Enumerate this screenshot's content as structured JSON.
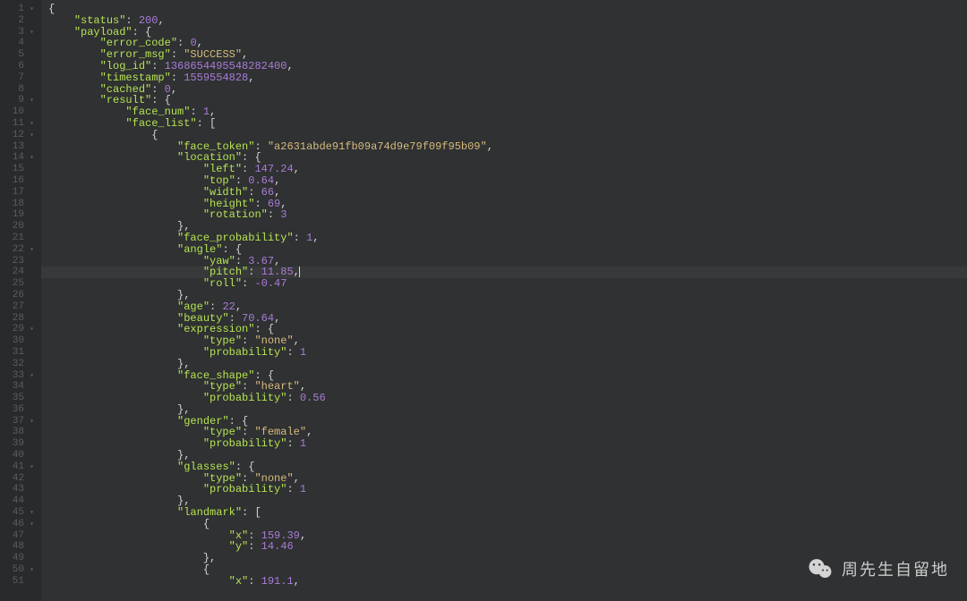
{
  "watermark_text": "周先生自留地",
  "active_line": 24,
  "code_lines": [
    {
      "num": 1,
      "fold": true,
      "indent": 0,
      "tokens": [
        {
          "t": "p",
          "v": "{"
        }
      ]
    },
    {
      "num": 2,
      "fold": false,
      "indent": 1,
      "tokens": [
        {
          "t": "k",
          "v": "\"status\""
        },
        {
          "t": "p",
          "v": ": "
        },
        {
          "t": "n",
          "v": "200"
        },
        {
          "t": "p",
          "v": ","
        }
      ]
    },
    {
      "num": 3,
      "fold": true,
      "indent": 1,
      "tokens": [
        {
          "t": "k",
          "v": "\"payload\""
        },
        {
          "t": "p",
          "v": ": {"
        }
      ]
    },
    {
      "num": 4,
      "fold": false,
      "indent": 2,
      "tokens": [
        {
          "t": "k",
          "v": "\"error_code\""
        },
        {
          "t": "p",
          "v": ": "
        },
        {
          "t": "n",
          "v": "0"
        },
        {
          "t": "p",
          "v": ","
        }
      ]
    },
    {
      "num": 5,
      "fold": false,
      "indent": 2,
      "tokens": [
        {
          "t": "k",
          "v": "\"error_msg\""
        },
        {
          "t": "p",
          "v": ": "
        },
        {
          "t": "s",
          "v": "\"SUCCESS\""
        },
        {
          "t": "p",
          "v": ","
        }
      ]
    },
    {
      "num": 6,
      "fold": false,
      "indent": 2,
      "tokens": [
        {
          "t": "k",
          "v": "\"log_id\""
        },
        {
          "t": "p",
          "v": ": "
        },
        {
          "t": "n",
          "v": "1368654495548282400"
        },
        {
          "t": "p",
          "v": ","
        }
      ]
    },
    {
      "num": 7,
      "fold": false,
      "indent": 2,
      "tokens": [
        {
          "t": "k",
          "v": "\"timestamp\""
        },
        {
          "t": "p",
          "v": ": "
        },
        {
          "t": "n",
          "v": "1559554828"
        },
        {
          "t": "p",
          "v": ","
        }
      ]
    },
    {
      "num": 8,
      "fold": false,
      "indent": 2,
      "tokens": [
        {
          "t": "k",
          "v": "\"cached\""
        },
        {
          "t": "p",
          "v": ": "
        },
        {
          "t": "n",
          "v": "0"
        },
        {
          "t": "p",
          "v": ","
        }
      ]
    },
    {
      "num": 9,
      "fold": true,
      "indent": 2,
      "tokens": [
        {
          "t": "k",
          "v": "\"result\""
        },
        {
          "t": "p",
          "v": ": {"
        }
      ]
    },
    {
      "num": 10,
      "fold": false,
      "indent": 3,
      "tokens": [
        {
          "t": "k",
          "v": "\"face_num\""
        },
        {
          "t": "p",
          "v": ": "
        },
        {
          "t": "n",
          "v": "1"
        },
        {
          "t": "p",
          "v": ","
        }
      ]
    },
    {
      "num": 11,
      "fold": true,
      "indent": 3,
      "tokens": [
        {
          "t": "k",
          "v": "\"face_list\""
        },
        {
          "t": "p",
          "v": ": ["
        }
      ]
    },
    {
      "num": 12,
      "fold": true,
      "indent": 4,
      "tokens": [
        {
          "t": "p",
          "v": "{"
        }
      ]
    },
    {
      "num": 13,
      "fold": false,
      "indent": 5,
      "tokens": [
        {
          "t": "k",
          "v": "\"face_token\""
        },
        {
          "t": "p",
          "v": ": "
        },
        {
          "t": "s",
          "v": "\"a2631abde91fb09a74d9e79f09f95b09\""
        },
        {
          "t": "p",
          "v": ","
        }
      ]
    },
    {
      "num": 14,
      "fold": true,
      "indent": 5,
      "tokens": [
        {
          "t": "k",
          "v": "\"location\""
        },
        {
          "t": "p",
          "v": ": {"
        }
      ]
    },
    {
      "num": 15,
      "fold": false,
      "indent": 6,
      "tokens": [
        {
          "t": "k",
          "v": "\"left\""
        },
        {
          "t": "p",
          "v": ": "
        },
        {
          "t": "n",
          "v": "147.24"
        },
        {
          "t": "p",
          "v": ","
        }
      ]
    },
    {
      "num": 16,
      "fold": false,
      "indent": 6,
      "tokens": [
        {
          "t": "k",
          "v": "\"top\""
        },
        {
          "t": "p",
          "v": ": "
        },
        {
          "t": "n",
          "v": "0.64"
        },
        {
          "t": "p",
          "v": ","
        }
      ]
    },
    {
      "num": 17,
      "fold": false,
      "indent": 6,
      "tokens": [
        {
          "t": "k",
          "v": "\"width\""
        },
        {
          "t": "p",
          "v": ": "
        },
        {
          "t": "n",
          "v": "66"
        },
        {
          "t": "p",
          "v": ","
        }
      ]
    },
    {
      "num": 18,
      "fold": false,
      "indent": 6,
      "tokens": [
        {
          "t": "k",
          "v": "\"height\""
        },
        {
          "t": "p",
          "v": ": "
        },
        {
          "t": "n",
          "v": "69"
        },
        {
          "t": "p",
          "v": ","
        }
      ]
    },
    {
      "num": 19,
      "fold": false,
      "indent": 6,
      "tokens": [
        {
          "t": "k",
          "v": "\"rotation\""
        },
        {
          "t": "p",
          "v": ": "
        },
        {
          "t": "n",
          "v": "3"
        }
      ]
    },
    {
      "num": 20,
      "fold": false,
      "indent": 5,
      "tokens": [
        {
          "t": "p",
          "v": "},"
        }
      ]
    },
    {
      "num": 21,
      "fold": false,
      "indent": 5,
      "tokens": [
        {
          "t": "k",
          "v": "\"face_probability\""
        },
        {
          "t": "p",
          "v": ": "
        },
        {
          "t": "n",
          "v": "1"
        },
        {
          "t": "p",
          "v": ","
        }
      ]
    },
    {
      "num": 22,
      "fold": true,
      "indent": 5,
      "tokens": [
        {
          "t": "k",
          "v": "\"angle\""
        },
        {
          "t": "p",
          "v": ": {"
        }
      ]
    },
    {
      "num": 23,
      "fold": false,
      "indent": 6,
      "tokens": [
        {
          "t": "k",
          "v": "\"yaw\""
        },
        {
          "t": "p",
          "v": ": "
        },
        {
          "t": "n",
          "v": "3.67"
        },
        {
          "t": "p",
          "v": ","
        }
      ]
    },
    {
      "num": 24,
      "fold": false,
      "indent": 6,
      "tokens": [
        {
          "t": "k",
          "v": "\"pitch\""
        },
        {
          "t": "p",
          "v": ": "
        },
        {
          "t": "n",
          "v": "11.85"
        },
        {
          "t": "p",
          "v": ","
        },
        {
          "t": "cursor",
          "v": ""
        }
      ]
    },
    {
      "num": 25,
      "fold": false,
      "indent": 6,
      "tokens": [
        {
          "t": "k",
          "v": "\"roll\""
        },
        {
          "t": "p",
          "v": ": "
        },
        {
          "t": "n",
          "v": "-0.47"
        }
      ]
    },
    {
      "num": 26,
      "fold": false,
      "indent": 5,
      "tokens": [
        {
          "t": "p",
          "v": "},"
        }
      ]
    },
    {
      "num": 27,
      "fold": false,
      "indent": 5,
      "tokens": [
        {
          "t": "k",
          "v": "\"age\""
        },
        {
          "t": "p",
          "v": ": "
        },
        {
          "t": "n",
          "v": "22"
        },
        {
          "t": "p",
          "v": ","
        }
      ]
    },
    {
      "num": 28,
      "fold": false,
      "indent": 5,
      "tokens": [
        {
          "t": "k",
          "v": "\"beauty\""
        },
        {
          "t": "p",
          "v": ": "
        },
        {
          "t": "n",
          "v": "70.64"
        },
        {
          "t": "p",
          "v": ","
        }
      ]
    },
    {
      "num": 29,
      "fold": true,
      "indent": 5,
      "tokens": [
        {
          "t": "k",
          "v": "\"expression\""
        },
        {
          "t": "p",
          "v": ": {"
        }
      ]
    },
    {
      "num": 30,
      "fold": false,
      "indent": 6,
      "tokens": [
        {
          "t": "k",
          "v": "\"type\""
        },
        {
          "t": "p",
          "v": ": "
        },
        {
          "t": "s",
          "v": "\"none\""
        },
        {
          "t": "p",
          "v": ","
        }
      ]
    },
    {
      "num": 31,
      "fold": false,
      "indent": 6,
      "tokens": [
        {
          "t": "k",
          "v": "\"probability\""
        },
        {
          "t": "p",
          "v": ": "
        },
        {
          "t": "n",
          "v": "1"
        }
      ]
    },
    {
      "num": 32,
      "fold": false,
      "indent": 5,
      "tokens": [
        {
          "t": "p",
          "v": "},"
        }
      ]
    },
    {
      "num": 33,
      "fold": true,
      "indent": 5,
      "tokens": [
        {
          "t": "k",
          "v": "\"face_shape\""
        },
        {
          "t": "p",
          "v": ": {"
        }
      ]
    },
    {
      "num": 34,
      "fold": false,
      "indent": 6,
      "tokens": [
        {
          "t": "k",
          "v": "\"type\""
        },
        {
          "t": "p",
          "v": ": "
        },
        {
          "t": "s",
          "v": "\"heart\""
        },
        {
          "t": "p",
          "v": ","
        }
      ]
    },
    {
      "num": 35,
      "fold": false,
      "indent": 6,
      "tokens": [
        {
          "t": "k",
          "v": "\"probability\""
        },
        {
          "t": "p",
          "v": ": "
        },
        {
          "t": "n",
          "v": "0.56"
        }
      ]
    },
    {
      "num": 36,
      "fold": false,
      "indent": 5,
      "tokens": [
        {
          "t": "p",
          "v": "},"
        }
      ]
    },
    {
      "num": 37,
      "fold": true,
      "indent": 5,
      "tokens": [
        {
          "t": "k",
          "v": "\"gender\""
        },
        {
          "t": "p",
          "v": ": {"
        }
      ]
    },
    {
      "num": 38,
      "fold": false,
      "indent": 6,
      "tokens": [
        {
          "t": "k",
          "v": "\"type\""
        },
        {
          "t": "p",
          "v": ": "
        },
        {
          "t": "s",
          "v": "\"female\""
        },
        {
          "t": "p",
          "v": ","
        }
      ]
    },
    {
      "num": 39,
      "fold": false,
      "indent": 6,
      "tokens": [
        {
          "t": "k",
          "v": "\"probability\""
        },
        {
          "t": "p",
          "v": ": "
        },
        {
          "t": "n",
          "v": "1"
        }
      ]
    },
    {
      "num": 40,
      "fold": false,
      "indent": 5,
      "tokens": [
        {
          "t": "p",
          "v": "},"
        }
      ]
    },
    {
      "num": 41,
      "fold": true,
      "indent": 5,
      "tokens": [
        {
          "t": "k",
          "v": "\"glasses\""
        },
        {
          "t": "p",
          "v": ": {"
        }
      ]
    },
    {
      "num": 42,
      "fold": false,
      "indent": 6,
      "tokens": [
        {
          "t": "k",
          "v": "\"type\""
        },
        {
          "t": "p",
          "v": ": "
        },
        {
          "t": "s",
          "v": "\"none\""
        },
        {
          "t": "p",
          "v": ","
        }
      ]
    },
    {
      "num": 43,
      "fold": false,
      "indent": 6,
      "tokens": [
        {
          "t": "k",
          "v": "\"probability\""
        },
        {
          "t": "p",
          "v": ": "
        },
        {
          "t": "n",
          "v": "1"
        }
      ]
    },
    {
      "num": 44,
      "fold": false,
      "indent": 5,
      "tokens": [
        {
          "t": "p",
          "v": "},"
        }
      ]
    },
    {
      "num": 45,
      "fold": true,
      "indent": 5,
      "tokens": [
        {
          "t": "k",
          "v": "\"landmark\""
        },
        {
          "t": "p",
          "v": ": ["
        }
      ]
    },
    {
      "num": 46,
      "fold": true,
      "indent": 6,
      "tokens": [
        {
          "t": "p",
          "v": "{"
        }
      ]
    },
    {
      "num": 47,
      "fold": false,
      "indent": 7,
      "tokens": [
        {
          "t": "k",
          "v": "\"x\""
        },
        {
          "t": "p",
          "v": ": "
        },
        {
          "t": "n",
          "v": "159.39"
        },
        {
          "t": "p",
          "v": ","
        }
      ]
    },
    {
      "num": 48,
      "fold": false,
      "indent": 7,
      "tokens": [
        {
          "t": "k",
          "v": "\"y\""
        },
        {
          "t": "p",
          "v": ": "
        },
        {
          "t": "n",
          "v": "14.46"
        }
      ]
    },
    {
      "num": 49,
      "fold": false,
      "indent": 6,
      "tokens": [
        {
          "t": "p",
          "v": "},"
        }
      ]
    },
    {
      "num": 50,
      "fold": true,
      "indent": 6,
      "tokens": [
        {
          "t": "p",
          "v": "{"
        }
      ]
    },
    {
      "num": 51,
      "fold": false,
      "indent": 7,
      "tokens": [
        {
          "t": "k",
          "v": "\"x\""
        },
        {
          "t": "p",
          "v": ": "
        },
        {
          "t": "n",
          "v": "191.1"
        },
        {
          "t": "p",
          "v": ","
        }
      ]
    }
  ]
}
